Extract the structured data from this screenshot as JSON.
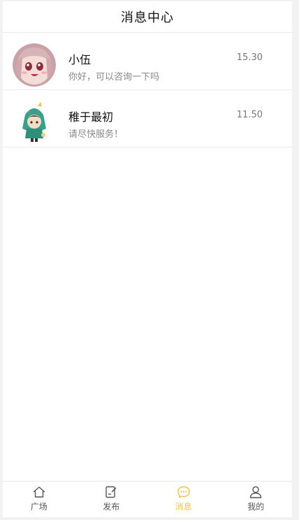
{
  "header": {
    "title": "消息中心"
  },
  "messages": [
    {
      "name": "小伍",
      "text": "你好，可以咨询一下吗",
      "time": "15.30"
    },
    {
      "name": "稚于最初",
      "text": "请尽快服务！",
      "time": "11.50"
    }
  ],
  "tabs": [
    {
      "label": "广场",
      "icon": "home-icon"
    },
    {
      "label": "发布",
      "icon": "edit-icon"
    },
    {
      "label": "消息",
      "icon": "chat-icon",
      "active": true
    },
    {
      "label": "我的",
      "icon": "user-icon"
    }
  ],
  "colors": {
    "accent": "#f0c24a",
    "text_muted": "#888888"
  }
}
